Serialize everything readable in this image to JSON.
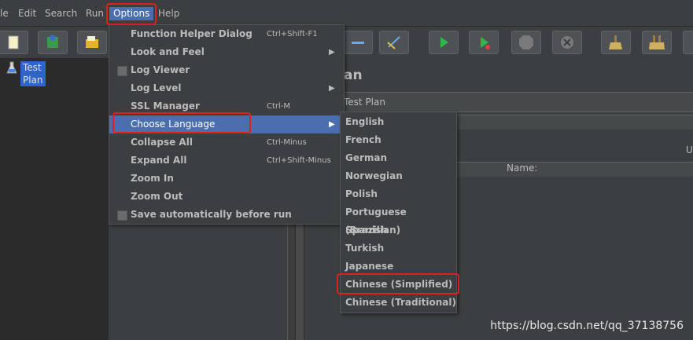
{
  "menubar": {
    "items": [
      {
        "label": "le"
      },
      {
        "label": "Edit"
      },
      {
        "label": "Search"
      },
      {
        "label": "Run"
      },
      {
        "label": "Options"
      },
      {
        "label": "Help"
      }
    ]
  },
  "tree": {
    "root_label": "Test Plan"
  },
  "panel": {
    "title": "an",
    "name_value": "Test Plan",
    "right_label": "U",
    "table_column": "Name:"
  },
  "options_menu": {
    "items": [
      {
        "label": "Function Helper Dialog",
        "accelerator": "Ctrl+Shift-F1"
      },
      {
        "label": "Look and Feel",
        "submenu_arrow": "▶"
      },
      {
        "label": "Log Viewer"
      },
      {
        "label": "Log Level",
        "submenu_arrow": "▶"
      },
      {
        "label": "SSL Manager",
        "accelerator": "Ctrl-M"
      },
      {
        "label": "Choose Language",
        "submenu_arrow": "▶"
      },
      {
        "label": "Collapse All",
        "accelerator": "Ctrl-Minus"
      },
      {
        "label": "Expand All",
        "accelerator": "Ctrl+Shift-Minus"
      },
      {
        "label": "Zoom In"
      },
      {
        "label": "Zoom Out"
      },
      {
        "label": "Save automatically before run"
      }
    ]
  },
  "language_menu": {
    "items": [
      {
        "label": "English"
      },
      {
        "label": "French"
      },
      {
        "label": "German"
      },
      {
        "label": "Norwegian"
      },
      {
        "label": "Polish"
      },
      {
        "label": "Portuguese (Brazilian)"
      },
      {
        "label": "Spanish"
      },
      {
        "label": "Turkish"
      },
      {
        "label": "Japanese"
      },
      {
        "label": "Chinese (Simplified)"
      },
      {
        "label": "Chinese (Traditional)"
      }
    ]
  },
  "watermark": "https://blog.csdn.net/qq_37138756",
  "colors": {
    "background": "#3c3f41",
    "highlight": "#4b6eaf",
    "callout": "#e02020"
  }
}
